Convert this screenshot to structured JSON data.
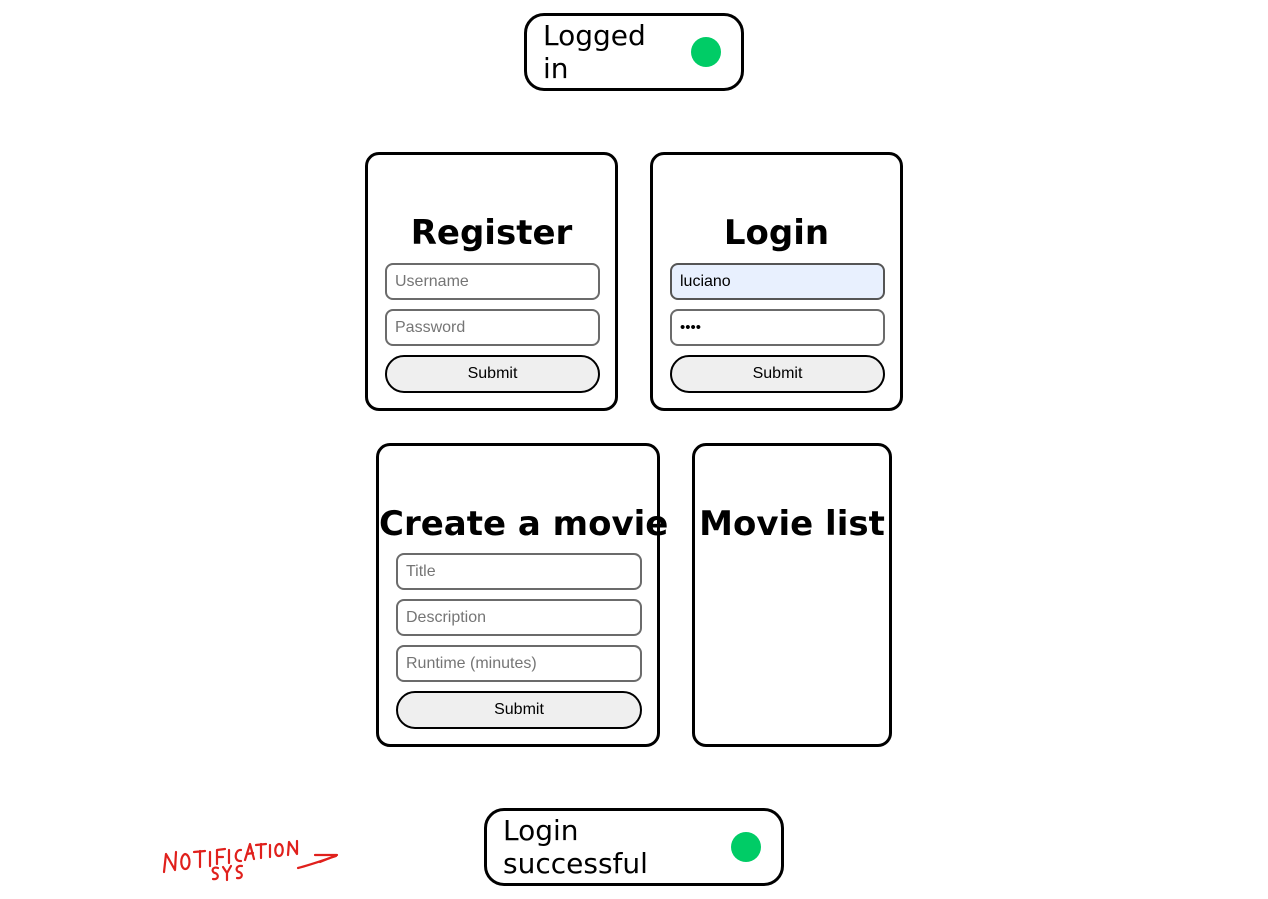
{
  "status": {
    "label": "Logged in",
    "dot_color": "#00cc66"
  },
  "register": {
    "title": "Register",
    "username_placeholder": "Username",
    "password_placeholder": "Password",
    "submit_label": "Submit"
  },
  "login": {
    "title": "Login",
    "username_value": "luciano",
    "password_value": "••••",
    "submit_label": "Submit"
  },
  "create_movie": {
    "title": "Create a movie",
    "title_placeholder": "Title",
    "description_placeholder": "Description",
    "runtime_placeholder": "Runtime (minutes)",
    "submit_label": "Submit"
  },
  "movie_list": {
    "title": "Movie list"
  },
  "notification": {
    "message": "Login successful",
    "dot_color": "#00cc66"
  },
  "annotation": {
    "text_line1": "NOTIFICATION",
    "text_line2": "SYS",
    "color": "#e0201c"
  }
}
